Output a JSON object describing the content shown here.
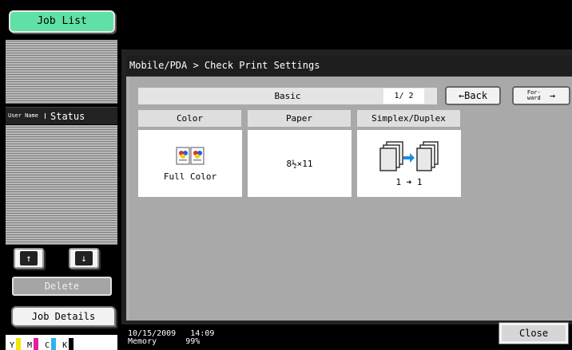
{
  "left_panel": {
    "job_list_label": "Job List",
    "header_user": "User Name",
    "header_status": "Status",
    "up_arrow": "↑",
    "down_arrow": "↓",
    "delete_label": "Delete",
    "job_details_label": "Job Details",
    "toner": [
      {
        "label": "Y",
        "color": "#f2e600"
      },
      {
        "label": "M",
        "color": "#e020a0"
      },
      {
        "label": "C",
        "color": "#29b6e8"
      },
      {
        "label": "K",
        "color": "#000000"
      }
    ]
  },
  "main": {
    "breadcrumb": "Mobile/PDA > Check Print Settings",
    "tab_label": "Basic",
    "page_indicator": "1/ 2",
    "back_label": "←Back",
    "forward_label": "For-ward",
    "forward_arrow": "→",
    "columns": [
      {
        "header": "Color",
        "value": "Full Color",
        "icon": "color-pages-icon"
      },
      {
        "header": "Paper",
        "value": "8½×11",
        "icon": ""
      },
      {
        "header": "Simplex/Duplex",
        "value": "1 ➜ 1",
        "icon": "simplex-pages-icon"
      }
    ]
  },
  "footer": {
    "date": "10/15/2009",
    "time": "14:09",
    "memory_label": "Memory",
    "memory_value": "99%",
    "close_label": "Close"
  }
}
